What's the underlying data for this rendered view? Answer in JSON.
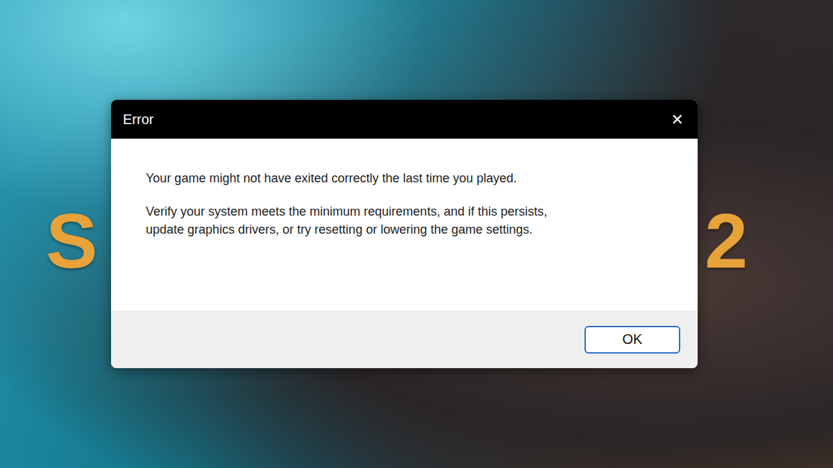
{
  "background": {
    "logo_left": "S",
    "logo_right": "2"
  },
  "dialog": {
    "title": "Error",
    "close": "✕",
    "paragraphs": [
      [
        "Your game might not have exited correctly the last time you played."
      ],
      [
        "Verify your system meets the minimum requirements, and if this persists,",
        "update graphics drivers, or try resetting or lowering the game settings."
      ]
    ],
    "buttons": [
      "OK"
    ]
  }
}
